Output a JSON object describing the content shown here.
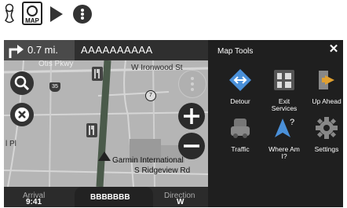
{
  "instructions": {
    "map_button_label": "MAP"
  },
  "navigation": {
    "distance": "0.7 mi.",
    "next_road": "AAAAAAAAAA",
    "streets": {
      "top_left": "Otis Pkwy",
      "ironwood": "W Ironwood St",
      "left_pl": "l Pl",
      "garmin": "Garmin International",
      "ridgeview": "S Ridgeview Rd"
    },
    "route_shields": {
      "i35": "35",
      "r7": "7"
    }
  },
  "bottom_bar": {
    "arrival_label": "Arrival",
    "arrival_value": "9:41",
    "center_value": "BBBBBBB",
    "direction_label": "Direction",
    "direction_value": "W"
  },
  "map_tools": {
    "title": "Map Tools",
    "items": [
      {
        "label": "Detour",
        "icon": "detour-icon"
      },
      {
        "label": "Exit Services",
        "icon": "exit-services-icon"
      },
      {
        "label": "Up Ahead",
        "icon": "up-ahead-icon"
      },
      {
        "label": "Traffic",
        "icon": "traffic-icon"
      },
      {
        "label": "Where Am I?",
        "icon": "where-am-i-icon"
      },
      {
        "label": "Settings",
        "icon": "settings-icon"
      }
    ]
  },
  "colors": {
    "map_background": "#b5b5b5",
    "panel_background": "#1f1f1f",
    "route_green": "#4a5a4a"
  }
}
